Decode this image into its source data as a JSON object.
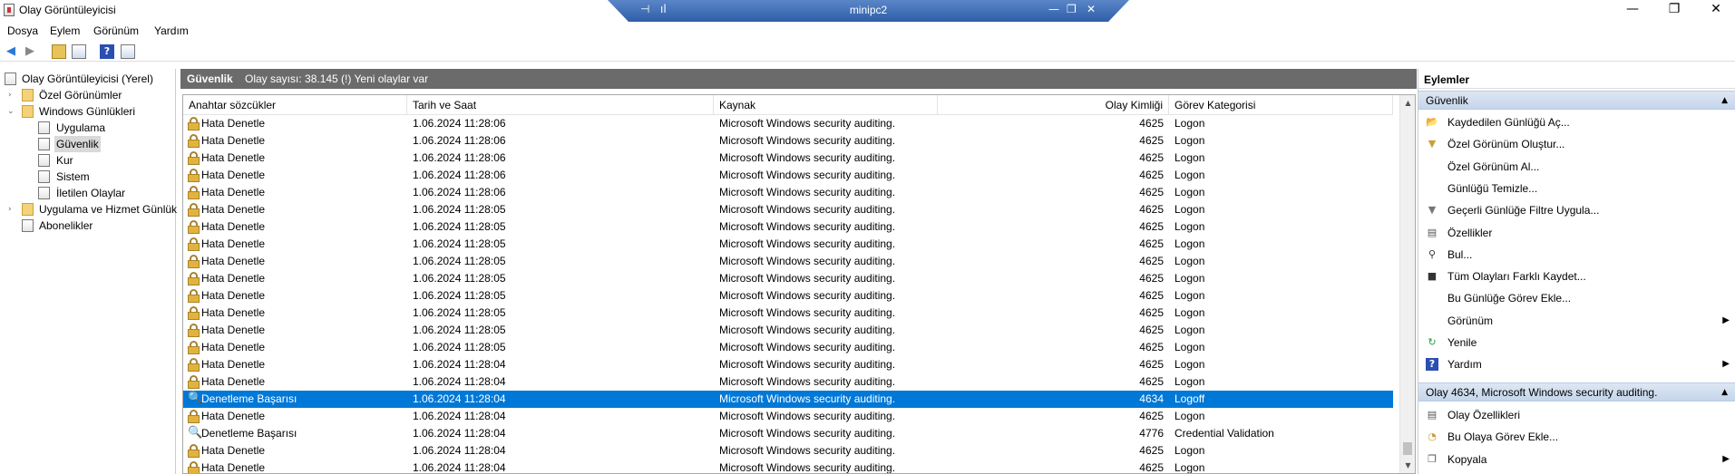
{
  "window": {
    "title": "Olay Görüntüleyicisi",
    "minimize": "—",
    "maximize": "❐",
    "close": "✕"
  },
  "rdp": {
    "title": "minipc2",
    "pin": "⊣",
    "signal": "ıl",
    "minimize": "—",
    "restore": "❐",
    "close": "✕"
  },
  "menu": [
    "Dosya",
    "Eylem",
    "Görünüm",
    "Yardım"
  ],
  "tree": {
    "root": "Olay Görüntüleyicisi (Yerel)",
    "custom_views": "Özel Görünümler",
    "windows_logs": "Windows Günlükleri",
    "logs": [
      "Uygulama",
      "Güvenlik",
      "Kur",
      "Sistem",
      "İletilen Olaylar"
    ],
    "app_service": "Uygulama ve Hizmet Günlük",
    "subscriptions": "Abonelikler"
  },
  "center": {
    "name": "Güvenlik",
    "count": "Olay sayısı: 38.145 (!) Yeni olaylar var",
    "columns": [
      "Anahtar sözcükler",
      "Tarih ve Saat",
      "Kaynak",
      "Olay Kimliği",
      "Görev Kategorisi"
    ],
    "rows": [
      {
        "kw": "Hata Denetle",
        "dt": "1.06.2024 11:28:06",
        "src": "Microsoft Windows security auditing.",
        "id": "4625",
        "cat": "Logon",
        "type": "fail"
      },
      {
        "kw": "Hata Denetle",
        "dt": "1.06.2024 11:28:06",
        "src": "Microsoft Windows security auditing.",
        "id": "4625",
        "cat": "Logon",
        "type": "fail"
      },
      {
        "kw": "Hata Denetle",
        "dt": "1.06.2024 11:28:06",
        "src": "Microsoft Windows security auditing.",
        "id": "4625",
        "cat": "Logon",
        "type": "fail"
      },
      {
        "kw": "Hata Denetle",
        "dt": "1.06.2024 11:28:06",
        "src": "Microsoft Windows security auditing.",
        "id": "4625",
        "cat": "Logon",
        "type": "fail"
      },
      {
        "kw": "Hata Denetle",
        "dt": "1.06.2024 11:28:06",
        "src": "Microsoft Windows security auditing.",
        "id": "4625",
        "cat": "Logon",
        "type": "fail"
      },
      {
        "kw": "Hata Denetle",
        "dt": "1.06.2024 11:28:05",
        "src": "Microsoft Windows security auditing.",
        "id": "4625",
        "cat": "Logon",
        "type": "fail"
      },
      {
        "kw": "Hata Denetle",
        "dt": "1.06.2024 11:28:05",
        "src": "Microsoft Windows security auditing.",
        "id": "4625",
        "cat": "Logon",
        "type": "fail"
      },
      {
        "kw": "Hata Denetle",
        "dt": "1.06.2024 11:28:05",
        "src": "Microsoft Windows security auditing.",
        "id": "4625",
        "cat": "Logon",
        "type": "fail"
      },
      {
        "kw": "Hata Denetle",
        "dt": "1.06.2024 11:28:05",
        "src": "Microsoft Windows security auditing.",
        "id": "4625",
        "cat": "Logon",
        "type": "fail"
      },
      {
        "kw": "Hata Denetle",
        "dt": "1.06.2024 11:28:05",
        "src": "Microsoft Windows security auditing.",
        "id": "4625",
        "cat": "Logon",
        "type": "fail"
      },
      {
        "kw": "Hata Denetle",
        "dt": "1.06.2024 11:28:05",
        "src": "Microsoft Windows security auditing.",
        "id": "4625",
        "cat": "Logon",
        "type": "fail"
      },
      {
        "kw": "Hata Denetle",
        "dt": "1.06.2024 11:28:05",
        "src": "Microsoft Windows security auditing.",
        "id": "4625",
        "cat": "Logon",
        "type": "fail"
      },
      {
        "kw": "Hata Denetle",
        "dt": "1.06.2024 11:28:05",
        "src": "Microsoft Windows security auditing.",
        "id": "4625",
        "cat": "Logon",
        "type": "fail"
      },
      {
        "kw": "Hata Denetle",
        "dt": "1.06.2024 11:28:05",
        "src": "Microsoft Windows security auditing.",
        "id": "4625",
        "cat": "Logon",
        "type": "fail"
      },
      {
        "kw": "Hata Denetle",
        "dt": "1.06.2024 11:28:04",
        "src": "Microsoft Windows security auditing.",
        "id": "4625",
        "cat": "Logon",
        "type": "fail"
      },
      {
        "kw": "Hata Denetle",
        "dt": "1.06.2024 11:28:04",
        "src": "Microsoft Windows security auditing.",
        "id": "4625",
        "cat": "Logon",
        "type": "fail"
      },
      {
        "kw": "Denetleme Başarısı",
        "dt": "1.06.2024 11:28:04",
        "src": "Microsoft Windows security auditing.",
        "id": "4634",
        "cat": "Logoff",
        "type": "success",
        "selected": true
      },
      {
        "kw": "Hata Denetle",
        "dt": "1.06.2024 11:28:04",
        "src": "Microsoft Windows security auditing.",
        "id": "4625",
        "cat": "Logon",
        "type": "fail"
      },
      {
        "kw": "Denetleme Başarısı",
        "dt": "1.06.2024 11:28:04",
        "src": "Microsoft Windows security auditing.",
        "id": "4776",
        "cat": "Credential Validation",
        "type": "success"
      },
      {
        "kw": "Hata Denetle",
        "dt": "1.06.2024 11:28:04",
        "src": "Microsoft Windows security auditing.",
        "id": "4625",
        "cat": "Logon",
        "type": "fail"
      },
      {
        "kw": "Hata Denetle",
        "dt": "1.06.2024 11:28:04",
        "src": "Microsoft Windows security auditing.",
        "id": "4625",
        "cat": "Logon",
        "type": "fail"
      }
    ]
  },
  "actions": {
    "title": "Eylemler",
    "section1": "Güvenlik",
    "items1": [
      {
        "label": "Kaydedilen Günlüğü Aç...",
        "icon": "open-log-icon"
      },
      {
        "label": "Özel Görünüm Oluştur...",
        "icon": "filter-create-icon"
      },
      {
        "label": "Özel Görünüm Al...",
        "icon": ""
      },
      {
        "label": "Günlüğü Temizle...",
        "icon": ""
      },
      {
        "label": "Geçerli Günlüğe Filtre Uygula...",
        "icon": "filter-icon"
      },
      {
        "label": "Özellikler",
        "icon": "properties-icon"
      },
      {
        "label": "Bul...",
        "icon": "find-icon"
      },
      {
        "label": "Tüm Olayları Farklı Kaydet...",
        "icon": "save-icon"
      },
      {
        "label": "Bu Günlüğe Görev Ekle...",
        "icon": ""
      },
      {
        "label": "Görünüm",
        "icon": "",
        "submenu": true
      },
      {
        "label": "Yenile",
        "icon": "refresh-icon"
      },
      {
        "label": "Yardım",
        "icon": "help-icon",
        "submenu": true
      }
    ],
    "section2": "Olay 4634, Microsoft Windows security auditing.",
    "items2": [
      {
        "label": "Olay Özellikleri",
        "icon": "event-properties-icon"
      },
      {
        "label": "Bu Olaya Görev Ekle...",
        "icon": "task-icon"
      },
      {
        "label": "Kopyala",
        "icon": "copy-icon",
        "submenu": true
      }
    ]
  }
}
